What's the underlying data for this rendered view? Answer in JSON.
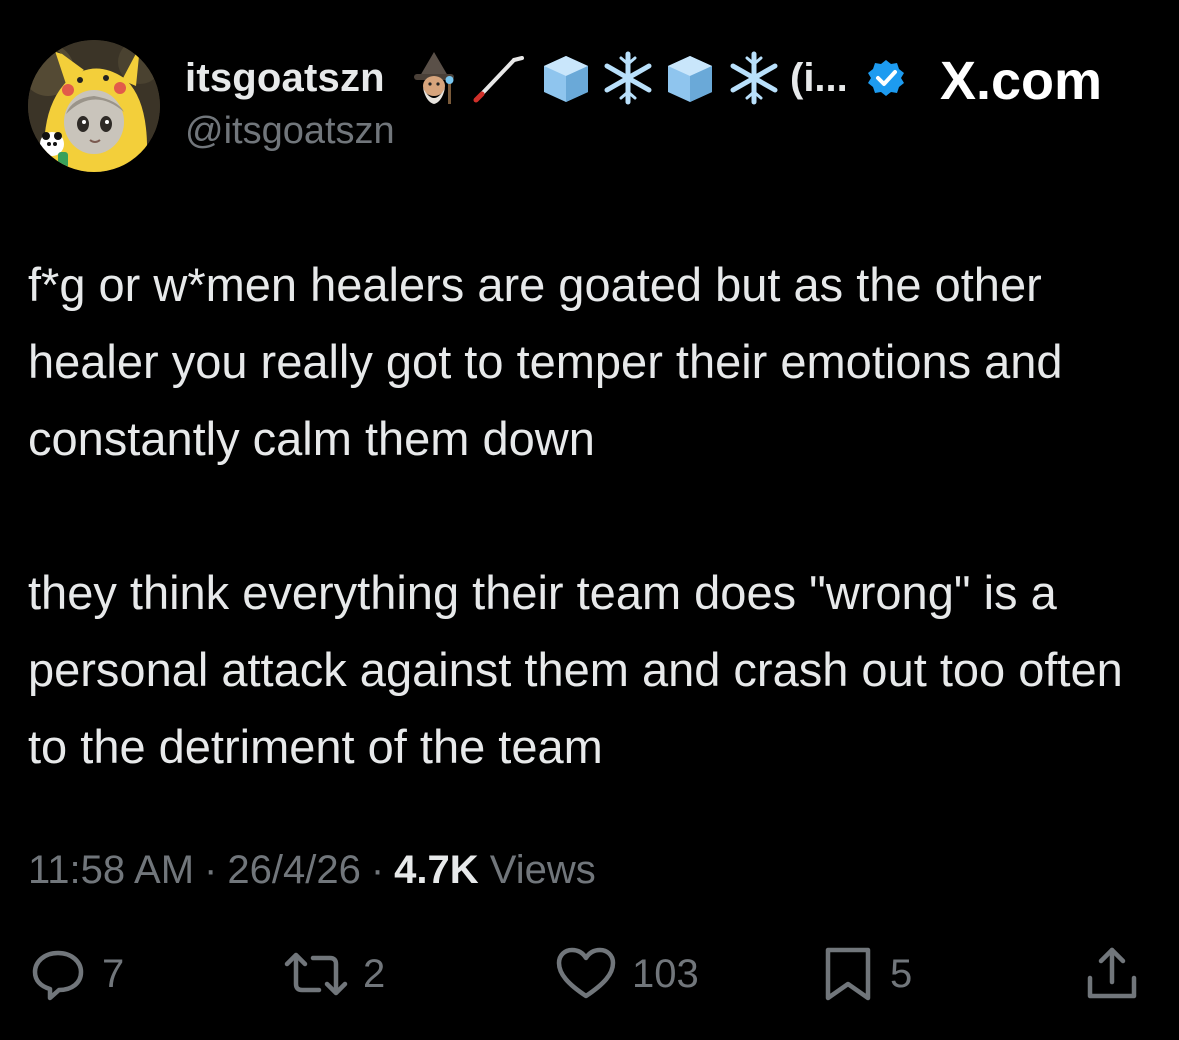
{
  "header": {
    "display_name": "itsgoatszn",
    "display_name_suffix": "(i...",
    "handle": "@itsgoatszn",
    "site_label": "X.com",
    "colors": {
      "verified": "#1d9bf0",
      "ice": "#8fc5ee"
    }
  },
  "tweet": {
    "paragraphs": [
      "f*g or w*men healers are goated but as the other healer you really got to temper their emotions and constantly calm them down",
      "they think everything their team does \"wrong\" is a personal attack against them and crash out too often to the detriment of the team"
    ]
  },
  "meta": {
    "time": "11:58 AM",
    "date": "26/4/26",
    "views_count": "4.7K",
    "views_label": "Views",
    "separator": "·"
  },
  "actions": {
    "replies": "7",
    "reposts": "2",
    "likes": "103",
    "bookmarks": "5"
  }
}
